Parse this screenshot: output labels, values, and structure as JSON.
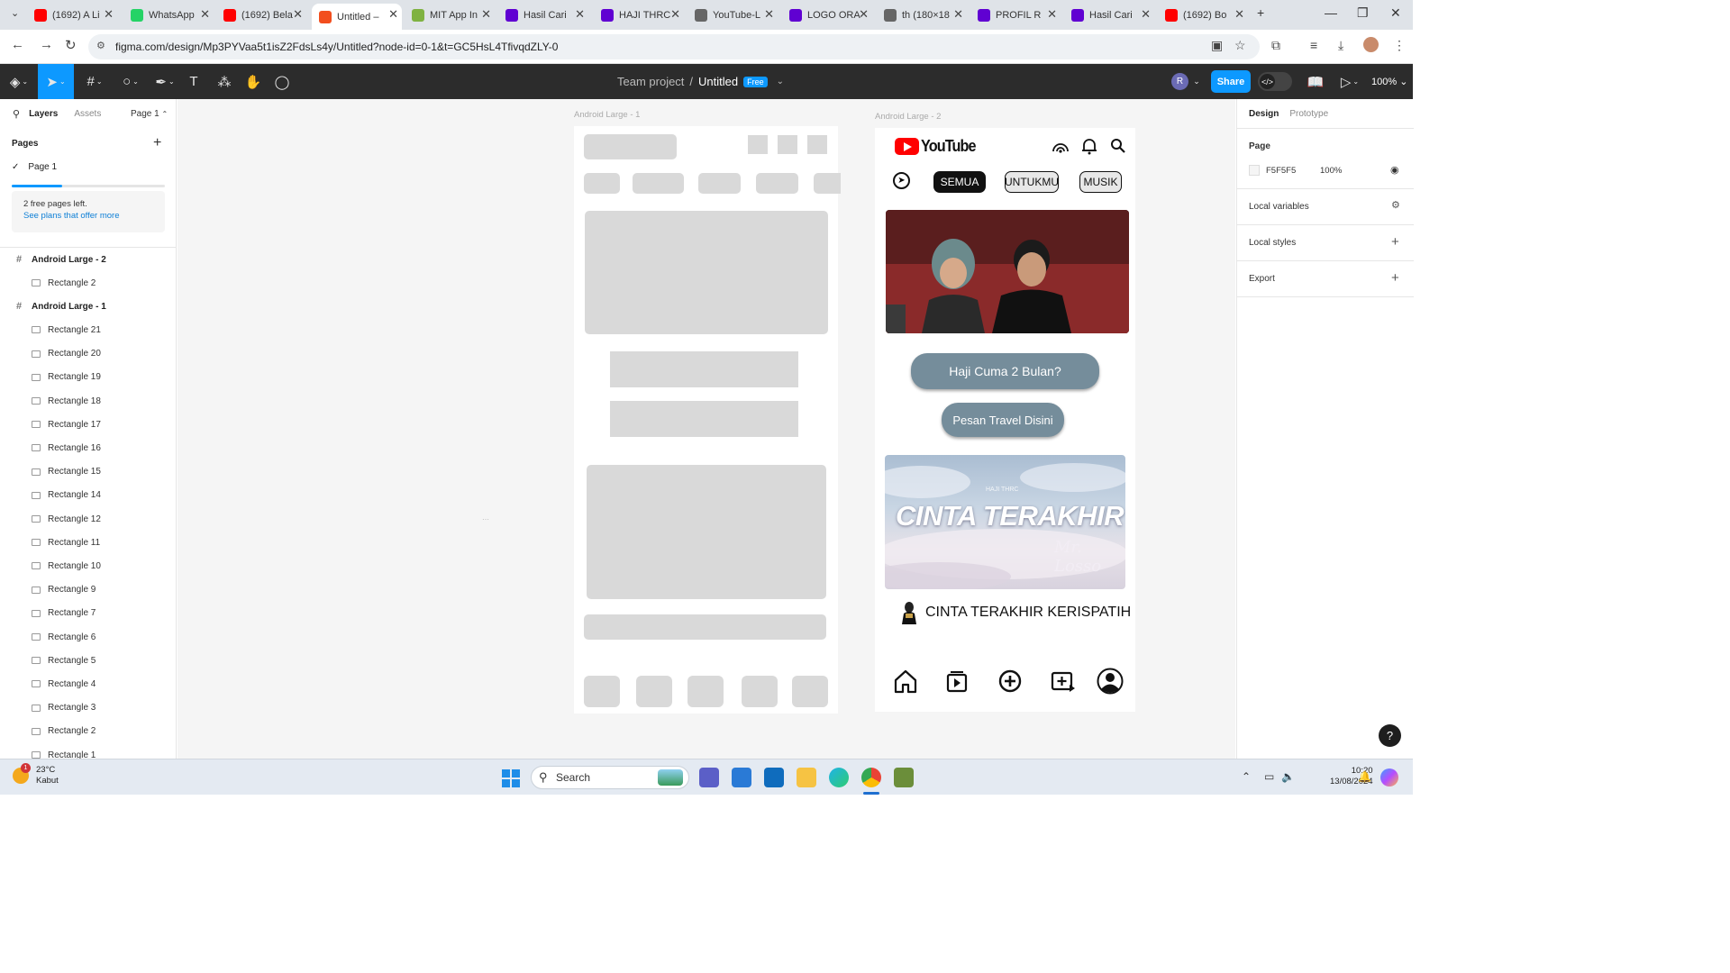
{
  "browser": {
    "tabs": [
      {
        "title": "(1692) A Li",
        "favicon": "youtube-icon",
        "color": "#ff0000"
      },
      {
        "title": "WhatsApp",
        "favicon": "whatsapp-icon",
        "color": "#25d366"
      },
      {
        "title": "(1692) Bela",
        "favicon": "youtube-icon",
        "color": "#ff0000"
      },
      {
        "title": "Untitled –",
        "favicon": "figma-icon",
        "color": "#f24e1e",
        "active": true
      },
      {
        "title": "MIT App In",
        "favicon": "mit-app-inventor-icon",
        "color": "#7fb241"
      },
      {
        "title": "Hasil Cari",
        "favicon": "yahoo-icon",
        "color": "#6001d2"
      },
      {
        "title": "HAJI THRC",
        "favicon": "yahoo-icon",
        "color": "#6001d2"
      },
      {
        "title": "YouTube-L",
        "favicon": "globe-icon",
        "color": "#666666"
      },
      {
        "title": "LOGO ORA",
        "favicon": "yahoo-icon",
        "color": "#6001d2"
      },
      {
        "title": "th (180×18",
        "favicon": "globe-icon",
        "color": "#666666"
      },
      {
        "title": "PROFIL R",
        "favicon": "yahoo-icon",
        "color": "#6001d2"
      },
      {
        "title": "Hasil Cari",
        "favicon": "yahoo-icon",
        "color": "#6001d2"
      },
      {
        "title": "(1692) Bo",
        "favicon": "youtube-icon",
        "color": "#ff0000"
      }
    ],
    "url": "figma.com/design/Mp3PYVaa5t1isZ2FdsLs4y/Untitled?node-id=0-1&t=GC5HsL4TfivqdZLY-0"
  },
  "figma": {
    "team": "Team project",
    "separator": "/",
    "file_name": "Untitled",
    "plan_badge": "Free",
    "user_initial": "R",
    "share_label": "Share",
    "zoom": "100%"
  },
  "left_panel": {
    "tab_layers": "Layers",
    "tab_assets": "Assets",
    "page_selector": "Page 1",
    "pages_heading": "Pages",
    "current_page": "Page 1",
    "pages_used_fraction": 0.33,
    "plan_notice": "2 free pages left.",
    "plan_link": "See plans that offer more",
    "layers": [
      {
        "name": "Android Large - 2",
        "type": "frame"
      },
      {
        "name": "Rectangle 2",
        "type": "child"
      },
      {
        "name": "Android Large - 1",
        "type": "frame"
      },
      {
        "name": "Rectangle 21",
        "type": "child"
      },
      {
        "name": "Rectangle 20",
        "type": "child"
      },
      {
        "name": "Rectangle 19",
        "type": "child"
      },
      {
        "name": "Rectangle 18",
        "type": "child"
      },
      {
        "name": "Rectangle 17",
        "type": "child"
      },
      {
        "name": "Rectangle 16",
        "type": "child"
      },
      {
        "name": "Rectangle 15",
        "type": "child"
      },
      {
        "name": "Rectangle 14",
        "type": "child"
      },
      {
        "name": "Rectangle 12",
        "type": "child"
      },
      {
        "name": "Rectangle 11",
        "type": "child"
      },
      {
        "name": "Rectangle 10",
        "type": "child"
      },
      {
        "name": "Rectangle 9",
        "type": "child"
      },
      {
        "name": "Rectangle 7",
        "type": "child"
      },
      {
        "name": "Rectangle 6",
        "type": "child"
      },
      {
        "name": "Rectangle 5",
        "type": "child"
      },
      {
        "name": "Rectangle 4",
        "type": "child"
      },
      {
        "name": "Rectangle 3",
        "type": "child"
      },
      {
        "name": "Rectangle 2",
        "type": "child"
      },
      {
        "name": "Rectangle 1",
        "type": "child"
      }
    ]
  },
  "canvas": {
    "frame1_label": "Android Large - 1",
    "frame2_label": "Android Large - 2",
    "placeholder_color": "#d9d9d9",
    "youtube": {
      "logo_text": "YouTube",
      "chips": [
        "SEMUA",
        "UNTUKMU",
        "MUSIK"
      ],
      "button_primary": "Haji Cuma 2 Bulan?",
      "button_secondary": "Pesan Travel Disini",
      "thumb2_small": "HAJI THRC",
      "thumb2_title": "CINTA TERAKHIR",
      "thumb2_script": "Mr. Losso",
      "video_title": "CINTA TERAKHIR KERISPATIH",
      "button_color": "#758d9b"
    }
  },
  "right_panel": {
    "tab_design": "Design",
    "tab_prototype": "Prototype",
    "page_heading": "Page",
    "bg_hex": "F5F5F5",
    "bg_opacity": "100%",
    "local_variables": "Local variables",
    "local_styles": "Local styles",
    "export": "Export",
    "help": "?"
  },
  "taskbar": {
    "temperature": "23°C",
    "weather": "Kabut",
    "weather_badge": "1",
    "search_placeholder": "Search",
    "time": "10:20",
    "date": "13/08/2024"
  }
}
